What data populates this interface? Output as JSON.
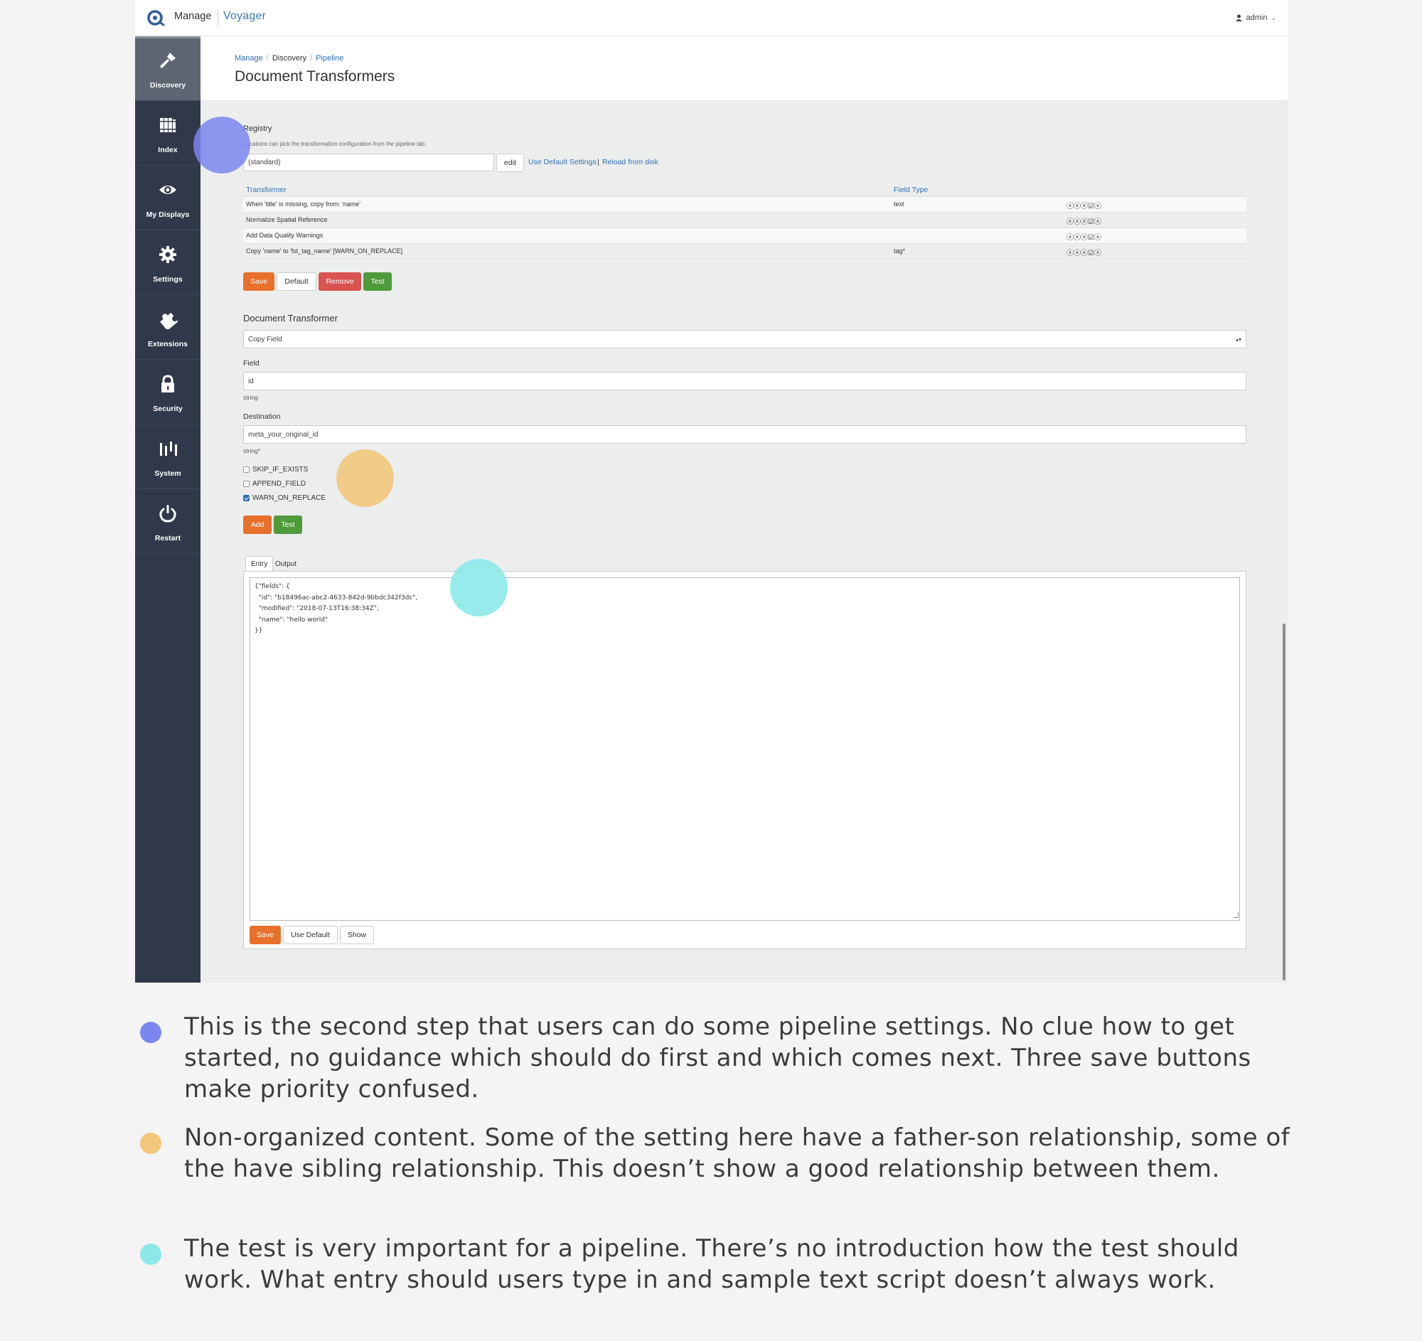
{
  "topbar": {
    "brand_manage": "Manage",
    "brand_voyager": "Voyager",
    "user": "admin"
  },
  "sidebar": {
    "items": [
      {
        "label": "Discovery",
        "icon": "flashlight-icon",
        "active": true
      },
      {
        "label": "Index",
        "icon": "books-icon"
      },
      {
        "label": "My Displays",
        "icon": "eye-icon"
      },
      {
        "label": "Settings",
        "icon": "gear-icon"
      },
      {
        "label": "Extensions",
        "icon": "puzzle-icon"
      },
      {
        "label": "Security",
        "icon": "lock-icon"
      },
      {
        "label": "System",
        "icon": "sliders-icon"
      },
      {
        "label": "Restart",
        "icon": "power-icon"
      }
    ]
  },
  "header": {
    "breadcrumb": [
      "Manage",
      "Discovery",
      "Pipeline"
    ],
    "title": "Document Transformers"
  },
  "registry": {
    "label": "Registry",
    "help": "Locations can pick the transformation configuration from the pipeline tab.",
    "value": "(standard)",
    "edit_label": "edit",
    "use_default_link": "Use Default Settings",
    "separator": "|",
    "reload_link": "Reload from disk"
  },
  "table": {
    "headers": [
      "Transformer",
      "Field Type"
    ],
    "rows": [
      {
        "transformer": "When 'title' is missing, copy from: 'name'",
        "field_type": "text",
        "actions": "ⓧⓧⓧ☑ⓧ"
      },
      {
        "transformer": "Normalize Spatial Reference",
        "field_type": "",
        "actions": "ⓧⓧⓧ☑ⓧ"
      },
      {
        "transformer": "Add Data Quality Warnings",
        "field_type": "",
        "actions": "ⓧⓧⓧ☑ⓧ"
      },
      {
        "transformer": "Copy 'name' to 'fst_tag_name' [WARN_ON_REPLACE]",
        "field_type": "tag*",
        "actions": "ⓧⓧⓧ☑ⓧ"
      }
    ],
    "buttons": {
      "save": "Save",
      "default": "Default",
      "remove": "Remove",
      "test": "Test"
    }
  },
  "doc_transformer": {
    "label": "Document Transformer",
    "selected": "Copy Field",
    "field_label": "Field",
    "field_value": "id",
    "field_type": "string",
    "destination_label": "Destination",
    "destination_value": "meta_your_original_id",
    "destination_type": "string*",
    "options": [
      {
        "label": "SKIP_IF_EXISTS",
        "checked": false
      },
      {
        "label": "APPEND_FIELD",
        "checked": false
      },
      {
        "label": "WARN_ON_REPLACE",
        "checked": true
      }
    ],
    "add_label": "Add",
    "test_label": "Test"
  },
  "test_panel": {
    "tabs": [
      "Entry",
      "Output"
    ],
    "code": "{\"fields\": {\n  \"id\": \"b18496ac-abc2-4633-842d-9bbdc342f3dc\",\n  \"modified\": \"2018-07-13T16:38:34Z\",\n  \"name\": \"hello world\"\n}}",
    "save_label": "Save",
    "use_default_label": "Use Default",
    "show_label": "Show"
  },
  "colors": {
    "blue_dot": "#7b86ee",
    "yellow_dot": "#f2c77c",
    "teal_dot": "#8de9e9",
    "orange": "#e8702a",
    "green": "#4f9a3b",
    "red": "#d9534f",
    "sidebar": "#30394a"
  },
  "notes": [
    {
      "text": "This is the second step that users can do some pipeline settings. No clue how to get started, no guidance which should do first and which comes next. Three save buttons make priority confused."
    },
    {
      "text": "Non-organized content. Some of the setting here have a father-son relationship, some of the have sibling relationship. This doesn’t show a good relationship between them."
    },
    {
      "text": "The test is very important for a pipeline. There’s no introduction how the test should work. What entry should users type in and sample text script doesn’t always work."
    }
  ]
}
